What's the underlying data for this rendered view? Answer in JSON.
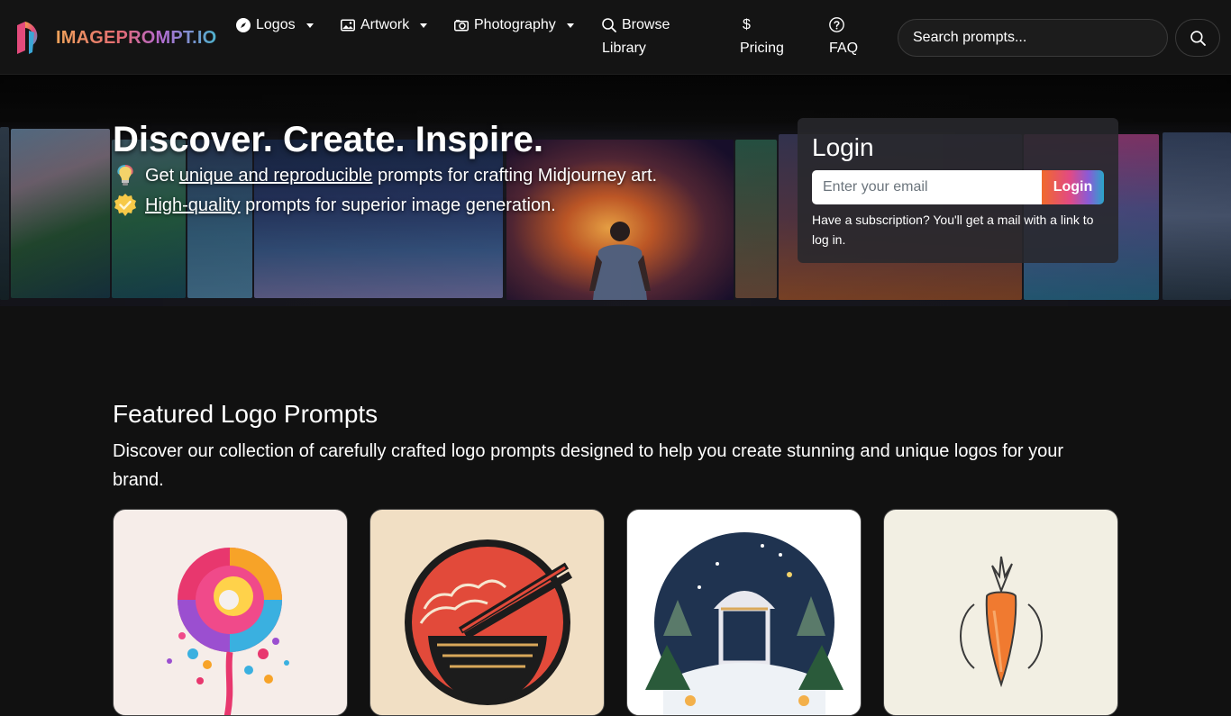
{
  "brand": {
    "name": "IMAGEPROMPT.IO"
  },
  "nav": {
    "logos": "Logos",
    "artwork": "Artwork",
    "photography": "Photography",
    "browse_line1": "Browse",
    "browse_line2": "Library",
    "pricing_symbol": "$",
    "pricing": "Pricing",
    "faq": "FAQ"
  },
  "search": {
    "placeholder": "Search prompts..."
  },
  "hero": {
    "title": "Discover. Create. Inspire.",
    "line1_prefix": "Get ",
    "line1_link": "unique and reproducible",
    "line1_suffix": " prompts for crafting Midjourney art.",
    "line2_link": "High-quality",
    "line2_suffix": " prompts for superior image generation."
  },
  "login": {
    "title": "Login",
    "email_placeholder": "Enter your email",
    "button": "Login",
    "note": "Have a subscription? You'll get a mail with a link to log in."
  },
  "featured": {
    "title": "Featured Logo Prompts",
    "description": "Discover our collection of carefully crafted logo prompts designed to help you create stunning and unique logos for your brand.",
    "cards": [
      {
        "icon": "lollipop-logo-image",
        "bg": "#f6ede9"
      },
      {
        "icon": "ramen-bowl-logo-image",
        "bg": "#f1dfc4"
      },
      {
        "icon": "winter-gazebo-logo-image",
        "bg": "#ffffff"
      },
      {
        "icon": "carrot-logo-image",
        "bg": "#f2efe3"
      }
    ]
  },
  "colors": {
    "accent_orange": "#f06a2c",
    "accent_pink": "#e24a84",
    "accent_purple": "#8a5bd6",
    "accent_cyan": "#29a6c9",
    "page_bg": "#111111"
  }
}
